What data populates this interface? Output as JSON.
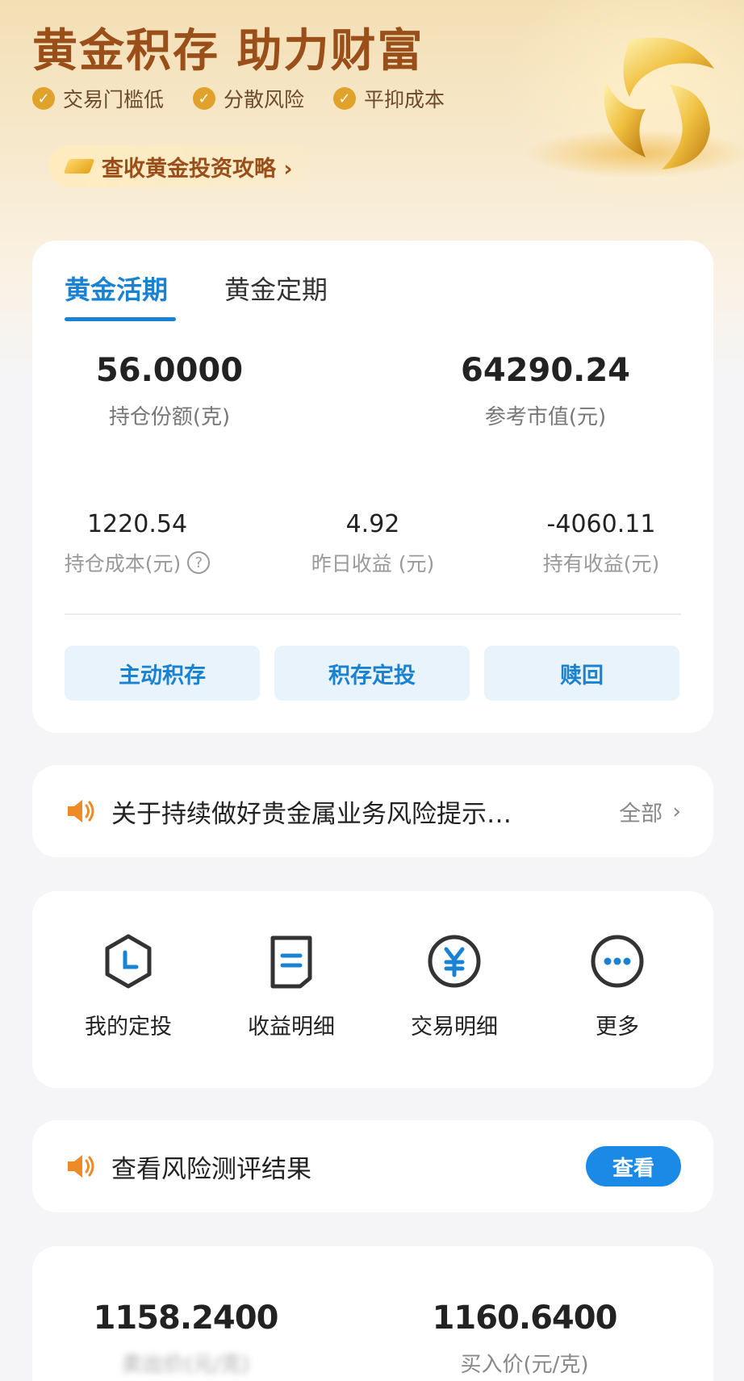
{
  "hero": {
    "title": "黄金积存 助力财富",
    "features": [
      "交易门槛低",
      "分散风险",
      "平抑成本"
    ],
    "guide_link": "查收黄金投资攻略 ›"
  },
  "tabs": [
    {
      "label": "黄金活期",
      "active": true
    },
    {
      "label": "黄金定期",
      "active": false
    }
  ],
  "holding": {
    "shares": {
      "value": "56.0000",
      "label": "持仓份额(克)"
    },
    "market_value": {
      "value": "64290.24",
      "label": "参考市值(元)"
    },
    "cost": {
      "value": "1220.54",
      "label": "持仓成本(元)"
    },
    "yesterday_profit": {
      "value": "4.92",
      "label": "昨日收益 (元)"
    },
    "total_profit": {
      "value": "-4060.11",
      "label": "持有收益(元)"
    }
  },
  "actions": [
    "主动积存",
    "积存定投",
    "赎回"
  ],
  "notice": {
    "text": "关于持续做好贵金属业务风险提示…",
    "more": "全部"
  },
  "shortcuts": [
    {
      "label": "我的定投",
      "icon": "clock-hexagon-icon"
    },
    {
      "label": "收益明细",
      "icon": "document-icon"
    },
    {
      "label": "交易明细",
      "icon": "yuan-circle-icon"
    },
    {
      "label": "更多",
      "icon": "more-dots-icon"
    }
  ],
  "risk": {
    "text": "查看风险测评结果",
    "button": "查看"
  },
  "prices": {
    "sell": {
      "value": "1158.2400",
      "label": "卖出价(元/克)"
    },
    "buy": {
      "value": "1160.6400",
      "label": "买入价(元/克)"
    }
  },
  "colors": {
    "accent": "#1a82d2",
    "gold_text": "#9a4e1a",
    "check": "#e0a22a"
  }
}
